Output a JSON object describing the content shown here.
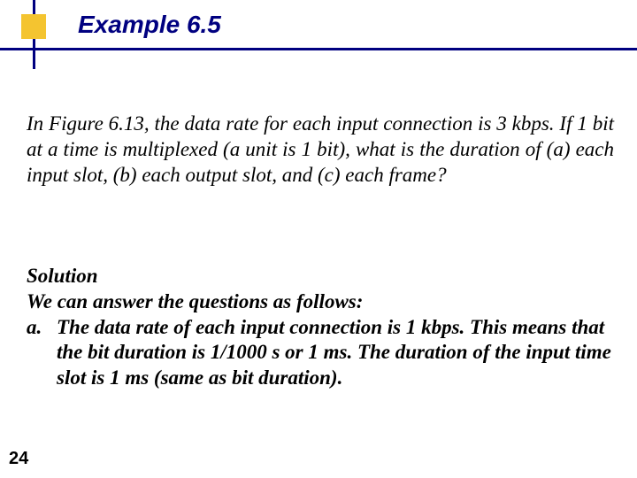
{
  "title": "Example 6.5",
  "question": "In Figure 6.13, the data rate for each input connection is 3 kbps. If 1 bit at a time is multiplexed (a unit is 1 bit), what is the duration of (a) each input slot, (b) each output slot, and (c) each frame?",
  "solution": {
    "heading": "Solution",
    "intro": "We can answer the questions as follows:",
    "items": [
      {
        "marker": "a.",
        "text": "The data rate of each input connection is 1 kbps. This means that the bit duration is 1/1000 s or 1 ms. The duration of the input time slot is 1 ms (same as bit duration)."
      }
    ]
  },
  "page_number": "24"
}
